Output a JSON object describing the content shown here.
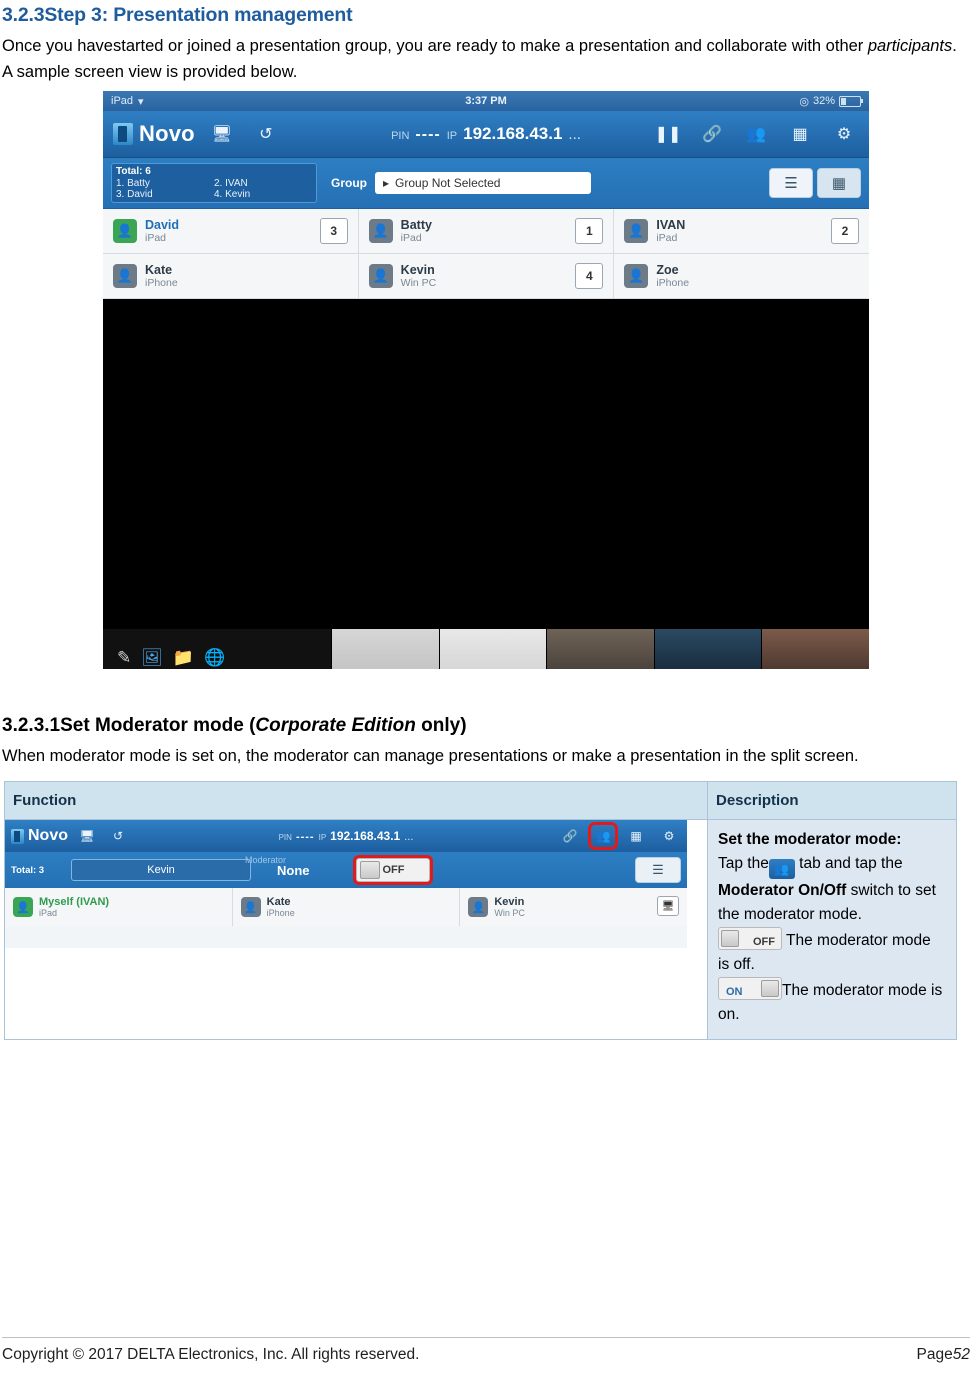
{
  "section": {
    "number": "3.2.3",
    "title": "Step 3: Presentation management",
    "paragraph_1a": "Once you havestarted or joined a presentation group, you are ready to make a presentation and collaborate with other ",
    "paragraph_1b": "participants",
    "paragraph_1c": ". A sample screen view is provided below."
  },
  "subsection": {
    "number": "3.2.3.1",
    "title_a": "Set Moderator mode (",
    "title_italic": "Corporate Edition",
    "title_b": " only)",
    "paragraph": "When moderator mode is set on, the moderator can manage presentations or make a presentation in the split screen."
  },
  "screenshot1": {
    "status_bar": {
      "device": "iPad",
      "wifi_icon": "wifi-icon",
      "time": "3:37 PM",
      "alarm_icon": "alarm-icon",
      "battery_pct": "32%"
    },
    "toolbar": {
      "logo": "Novo",
      "icons": [
        "screen-mirror-icon",
        "refresh-icon",
        "pause-icon",
        "link-icon",
        "moderator-icon",
        "grid-icon",
        "settings-icon"
      ],
      "pin_label": "PIN",
      "pin_value": "----",
      "ip_label": "IP",
      "ip_value": "192.168.43.1",
      "more": "..."
    },
    "group_bar": {
      "total_label": "Total: 6",
      "participants": [
        "1. Batty",
        "2. IVAN",
        "3. David",
        "4. Kevin"
      ],
      "group_label": "Group",
      "group_select_value": "Group Not Selected",
      "view_list_icon": "list-view-icon",
      "view_grid_icon": "grid-view-icon"
    },
    "participants": [
      {
        "name": "David",
        "device": "iPad",
        "badge": "3",
        "highlight": true
      },
      {
        "name": "Batty",
        "device": "iPad",
        "badge": "1",
        "highlight": false
      },
      {
        "name": "IVAN",
        "device": "iPad",
        "badge": "2",
        "highlight": false
      },
      {
        "name": "Kate",
        "device": "iPhone",
        "badge": "",
        "highlight": false
      },
      {
        "name": "Kevin",
        "device": "Win PC",
        "badge": "4",
        "highlight": false
      },
      {
        "name": "Zoe",
        "device": "iPhone",
        "badge": "",
        "highlight": false
      }
    ],
    "filmstrip_icons": [
      "pen-icon",
      "image-icon",
      "folder-icon",
      "browser-icon"
    ]
  },
  "table": {
    "headers": [
      "Function",
      "Description"
    ],
    "screenshot2": {
      "toolbar": {
        "logo": "Novo",
        "pin_label": "PIN",
        "pin_value": "----",
        "ip_label": "IP",
        "ip_value": "192.168.43.1",
        "more": "...",
        "icons": [
          "screen-mirror-icon",
          "refresh-icon",
          "link-icon",
          "moderator-icon",
          "grid-icon",
          "settings-icon"
        ]
      },
      "group_bar": {
        "total_label": "Total: 3",
        "selected_user": "Kevin",
        "moderator_label": "Moderator",
        "moderator_value": "None",
        "switch_text": "OFF",
        "list_icon": "list-view-icon"
      },
      "participants": [
        {
          "name": "Myself (IVAN)",
          "device": "iPad",
          "badge": ""
        },
        {
          "name": "Kate",
          "device": "iPhone",
          "badge": ""
        },
        {
          "name": "Kevin",
          "device": "Win PC",
          "badge": "screen-icon"
        }
      ]
    },
    "description": {
      "title": "Set the moderator mode:",
      "line1_a": "Tap the",
      "line1_icon": "moderator-icon",
      "line1_b": " tab and tap the ",
      "line1_bold": "Moderator On/Off",
      "line1_c": " switch to set the moderator mode.",
      "off_switch": "OFF",
      "off_text": " The moderator mode is off.",
      "on_switch": "ON",
      "on_text": "The moderator mode is on."
    }
  },
  "footer": {
    "copyright": "Copyright © 2017 DELTA Electronics, Inc. All rights reserved.",
    "page_label": "Page",
    "page_number": "52"
  }
}
